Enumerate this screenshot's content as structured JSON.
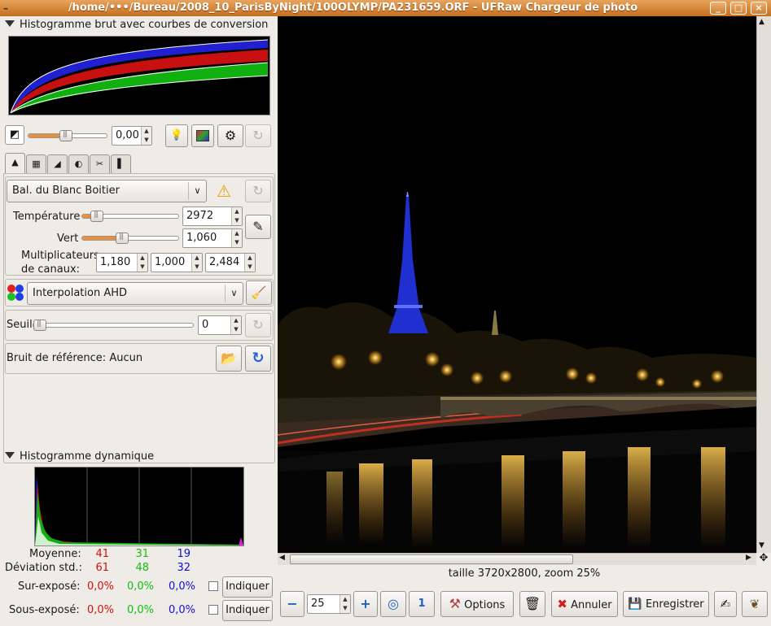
{
  "window": {
    "title": "/home/•••/Bureau/2008_10_ParisByNight/100OLYMP/PA231659.ORF - UFRaw Chargeur de photo",
    "menu_icon": "–",
    "minimize_icon": "_",
    "maximize_icon": "□",
    "close_icon": "×"
  },
  "raw_histogram": {
    "title": "Histogramme brut avec courbes de conversion"
  },
  "exposure": {
    "value": "0,00",
    "icon": "◩",
    "lightbulb_icon": "💡",
    "gears_icon": "⚙",
    "reset_icon": "↻",
    "level": 0.48
  },
  "tabs": [
    {
      "name": "tab-white-balance",
      "glyph": "▲"
    },
    {
      "name": "tab-curves",
      "glyph": "▦"
    },
    {
      "name": "tab-color-management",
      "glyph": "◢"
    },
    {
      "name": "tab-lightness",
      "glyph": "◐"
    },
    {
      "name": "tab-crop",
      "glyph": "✂"
    },
    {
      "name": "tab-exif",
      "glyph": "▌"
    }
  ],
  "white_balance": {
    "preset": "Bal. du Blanc Boitier",
    "arrow": "∨",
    "warning_icon": "⚠",
    "temperature_label": "Température",
    "temperature_value": "2972",
    "temperature_level": 0.1,
    "green_label": "Vert",
    "green_value": "1,060",
    "green_level": 0.4,
    "eyedropper_icon": "✎",
    "multipliers_label_1": "Multiplicateurs",
    "multipliers_label_2": "de canaux:",
    "multipliers": [
      "1,180",
      "1,000",
      "2,484"
    ]
  },
  "interpolation": {
    "value": "Interpolation AHD",
    "arrow": "∨",
    "brush_icon": "🧹"
  },
  "denoise": {
    "label": "Seuil",
    "value": "0",
    "level": 0
  },
  "dark_frame": {
    "label": "Bruit de référence:",
    "value": "Aucun",
    "folder_icon": "📂",
    "reload_icon": "↻"
  },
  "live_histogram": {
    "title": "Histogramme dynamique",
    "mean_label": "Moyenne:",
    "mean": [
      "41",
      "31",
      "19"
    ],
    "std_label": "Déviation std.:",
    "std": [
      "61",
      "48",
      "32"
    ],
    "over_label": "Sur-exposé:",
    "over": [
      "0,0%",
      "0,0%",
      "0,0%"
    ],
    "under_label": "Sous-exposé:",
    "under": [
      "0,0%",
      "0,0%",
      "0,0%"
    ],
    "indicate_label": "Indiquer"
  },
  "status": {
    "text": "taille 3720x2800, zoom 25%"
  },
  "toolbar": {
    "zoom_value": "25",
    "zoom_out_icon": "−",
    "zoom_in_icon": "+",
    "zoom_fit_icon": "◎",
    "zoom_100_icon": "1",
    "options_label": "Options",
    "options_icon": "⚒",
    "delete_icon": "🗑",
    "cancel_label": "Annuler",
    "cancel_icon": "✖",
    "save_label": "Enregistrer",
    "save_icon": "💾",
    "save_as_icon": "✍",
    "gimp_icon": "❦"
  },
  "colors": {
    "accent": "#e89040",
    "titlebar": "#d0802f"
  }
}
